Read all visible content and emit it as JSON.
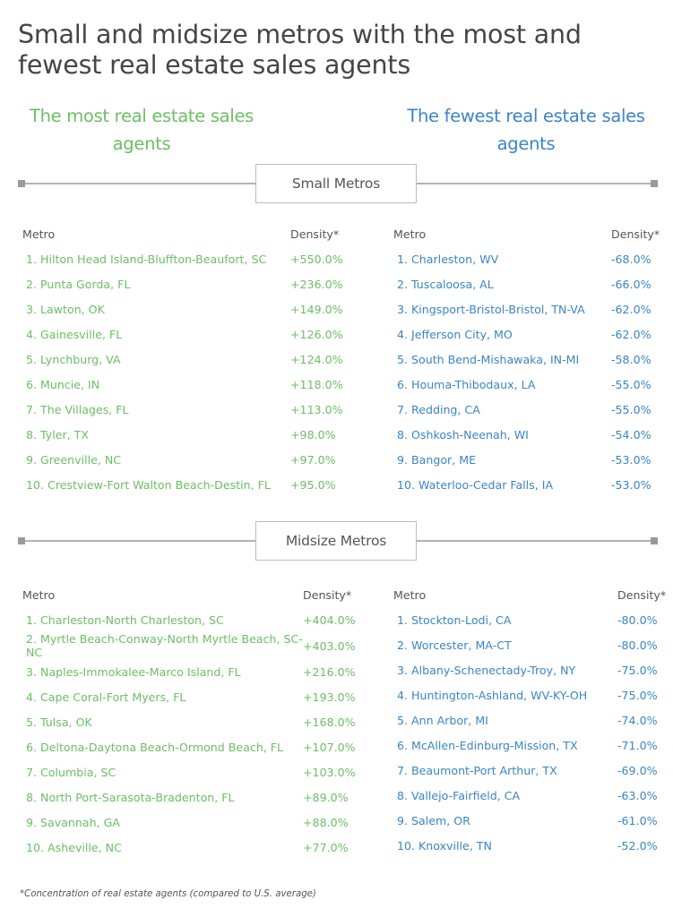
{
  "title": "Small and midsize metros with the most and fewest real estate sales agents",
  "subheadings": {
    "most": "The most real estate sales agents",
    "fewest": "The fewest real estate sales agents"
  },
  "colors": {
    "most": "#6dbe65",
    "fewest": "#3a85c6",
    "title": "#454545",
    "divider": "#b3b3b3"
  },
  "columns": {
    "metro": "Metro",
    "density": "Density*"
  },
  "small_metros": {
    "label": "Small Metros",
    "most": [
      {
        "metro": "1. Hilton Head Island-Bluffton-Beaufort, SC",
        "density": "+550.0%"
      },
      {
        "metro": "2. Punta Gorda, FL",
        "density": "+236.0%"
      },
      {
        "metro": "3. Lawton, OK",
        "density": "+149.0%"
      },
      {
        "metro": "4. Gainesville, FL",
        "density": "+126.0%"
      },
      {
        "metro": "5. Lynchburg, VA",
        "density": "+124.0%"
      },
      {
        "metro": "6. Muncie, IN",
        "density": "+118.0%"
      },
      {
        "metro": "7. The Villages, FL",
        "density": "+113.0%"
      },
      {
        "metro": "8. Tyler, TX",
        "density": "+98.0%"
      },
      {
        "metro": "9. Greenville, NC",
        "density": "+97.0%"
      },
      {
        "metro": "10. Crestview-Fort Walton Beach-Destin, FL",
        "density": "+95.0%"
      }
    ],
    "fewest": [
      {
        "metro": "1. Charleston, WV",
        "density": "-68.0%"
      },
      {
        "metro": "2. Tuscaloosa, AL",
        "density": "-66.0%"
      },
      {
        "metro": "3. Kingsport-Bristol-Bristol, TN-VA",
        "density": "-62.0%"
      },
      {
        "metro": "4. Jefferson City, MO",
        "density": "-62.0%"
      },
      {
        "metro": "5. South Bend-Mishawaka, IN-MI",
        "density": "-58.0%"
      },
      {
        "metro": "6. Houma-Thibodaux, LA",
        "density": "-55.0%"
      },
      {
        "metro": "7. Redding, CA",
        "density": "-55.0%"
      },
      {
        "metro": "8. Oshkosh-Neenah, WI",
        "density": "-54.0%"
      },
      {
        "metro": "9. Bangor, ME",
        "density": "-53.0%"
      },
      {
        "metro": "10. Waterloo-Cedar Falls, IA",
        "density": "-53.0%"
      }
    ]
  },
  "midsize_metros": {
    "label": "Midsize Metros",
    "most": [
      {
        "metro": "1. Charleston-North Charleston, SC",
        "density": "+404.0%"
      },
      {
        "metro": "2. Myrtle Beach-Conway-North Myrtle Beach, SC-NC",
        "density": "+403.0%"
      },
      {
        "metro": "3. Naples-Immokalee-Marco Island, FL",
        "density": "+216.0%"
      },
      {
        "metro": "4. Cape Coral-Fort Myers, FL",
        "density": "+193.0%"
      },
      {
        "metro": "5. Tulsa, OK",
        "density": "+168.0%"
      },
      {
        "metro": "6. Deltona-Daytona Beach-Ormond Beach, FL",
        "density": "+107.0%"
      },
      {
        "metro": "7. Columbia, SC",
        "density": "+103.0%"
      },
      {
        "metro": "8. North Port-Sarasota-Bradenton, FL",
        "density": "+89.0%"
      },
      {
        "metro": "9. Savannah, GA",
        "density": "+88.0%"
      },
      {
        "metro": "10. Asheville, NC",
        "density": "+77.0%"
      }
    ],
    "fewest": [
      {
        "metro": "1. Stockton-Lodi, CA",
        "density": "-80.0%"
      },
      {
        "metro": "2. Worcester, MA-CT",
        "density": "-80.0%"
      },
      {
        "metro": "3. Albany-Schenectady-Troy, NY",
        "density": "-75.0%"
      },
      {
        "metro": "4. Huntington-Ashland, WV-KY-OH",
        "density": "-75.0%"
      },
      {
        "metro": "5. Ann Arbor, MI",
        "density": "-74.0%"
      },
      {
        "metro": "6. McAllen-Edinburg-Mission, TX",
        "density": "-71.0%"
      },
      {
        "metro": "7. Beaumont-Port Arthur, TX",
        "density": "-69.0%"
      },
      {
        "metro": "8. Vallejo-Fairfield, CA",
        "density": "-63.0%"
      },
      {
        "metro": "9. Salem, OR",
        "density": "-61.0%"
      },
      {
        "metro": "10. Knoxville, TN",
        "density": "-52.0%"
      }
    ]
  },
  "footnote": "*Concentration of real estate agents (compared to U.S. average)"
}
